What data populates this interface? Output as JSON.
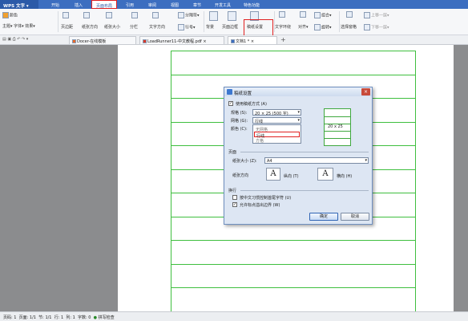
{
  "app": {
    "name": "WPS 文字",
    "menu": [
      "开始",
      "插入",
      "页面布局",
      "引用",
      "审阅",
      "视图",
      "章节",
      "开发工具",
      "特色功能"
    ],
    "active_menu": "页面布局"
  },
  "ribbon": {
    "theme": "主题",
    "color": "颜色",
    "font": "字体",
    "effect": "效果",
    "margin": "页边距",
    "orientation": "纸张方向",
    "size": "纸张大小",
    "columns": "分栏",
    "text_dir": "文字方向",
    "line_no": "行号",
    "breaks": "分隔符",
    "background": "背景",
    "border": "页面边框",
    "grid_settings": "稿纸设置",
    "wrap": "文字环绕",
    "align": "对齐",
    "rotate": "旋转",
    "group": "组合",
    "selection_pane": "选择窗格",
    "bring_forward": "上移一层",
    "send_backward": "下移一层"
  },
  "tabs": [
    {
      "label": "Docer-在线模板"
    },
    {
      "label": "LoadRunner11-中文教程.pdf"
    },
    {
      "label": "文档1 *"
    }
  ],
  "tab_add": "+",
  "status": {
    "page": "页码: 1",
    "pages": "页面: 1/1",
    "section": "节: 1/1",
    "row": "行: 1",
    "col": "列: 1",
    "words": "字数: 0",
    "spell": "拼写检查"
  },
  "dialog": {
    "title": "稿纸设置",
    "close": "×",
    "use_grid": "使用稿纸方式 (A)",
    "use_grid_checked": true,
    "spec_label": "规格 (S):",
    "spec_value": "20 × 25 (500 字)",
    "grid_label": "网格 (G):",
    "grid_value": "行线",
    "color_label": "颜色 (C):",
    "grid_options": [
      "无网格",
      "行线",
      "方格"
    ],
    "preview_text": "20 x 25",
    "page_group": "页面",
    "paper_size_label": "纸张大小 (Z):",
    "paper_size_value": "A4",
    "orient_label": "纸张方向",
    "portrait_glyph": "A",
    "portrait": "纵向 (T)",
    "landscape_glyph": "A",
    "landscape": "横向 (H)",
    "wrap_group": "换行",
    "wrap_opt1": "按中文习惯控制首尾字符 (U)",
    "wrap_opt1_checked": false,
    "wrap_opt2": "允许标点溢出边界 (W)",
    "wrap_opt2_checked": true,
    "ok": "确定",
    "cancel": "取消"
  },
  "colors": {
    "accent": "#3c6ec0",
    "grid": "#3fbf3f",
    "highlight": "#e02020"
  }
}
